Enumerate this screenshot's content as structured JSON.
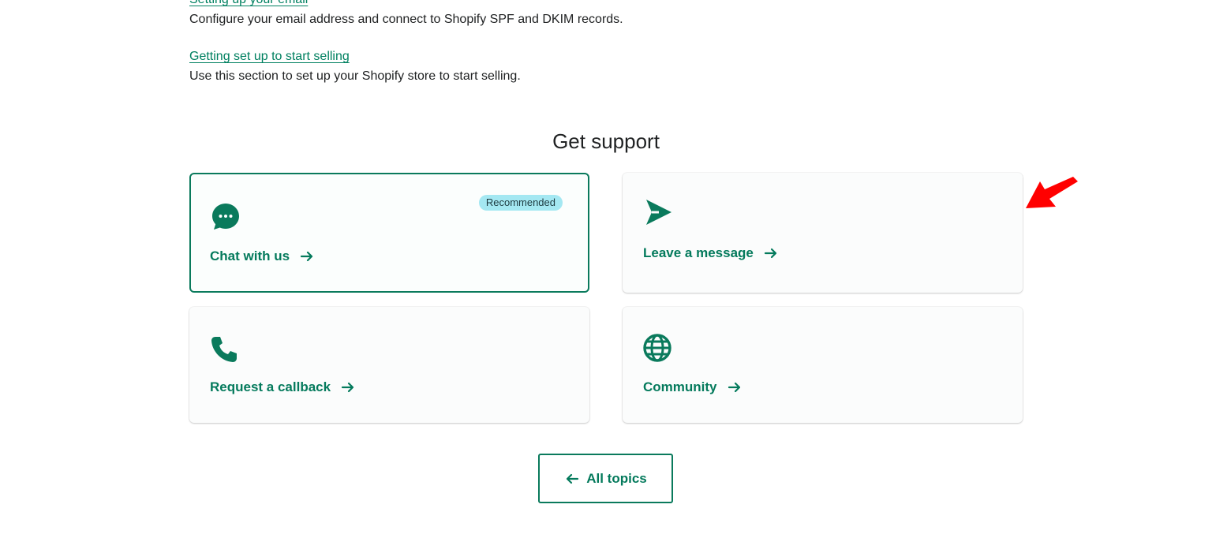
{
  "topics": [
    {
      "link": "Setting up your email",
      "description": "Configure your email address and connect to Shopify SPF and DKIM records."
    },
    {
      "link": "Getting set up to start selling",
      "description": "Use this section to set up your Shopify store to start selling."
    }
  ],
  "support": {
    "title": "Get support",
    "cards": [
      {
        "label": "Chat with us",
        "icon": "chat-bubble-icon",
        "badge": "Recommended"
      },
      {
        "label": "Leave a message",
        "icon": "send-icon"
      },
      {
        "label": "Request a callback",
        "icon": "phone-icon"
      },
      {
        "label": "Community",
        "icon": "globe-icon"
      }
    ]
  },
  "all_topics_button": {
    "label": "All topics"
  },
  "colors": {
    "brand": "#008060",
    "badge_bg": "#a4e8f2",
    "annotation_arrow": "#ff0000"
  }
}
